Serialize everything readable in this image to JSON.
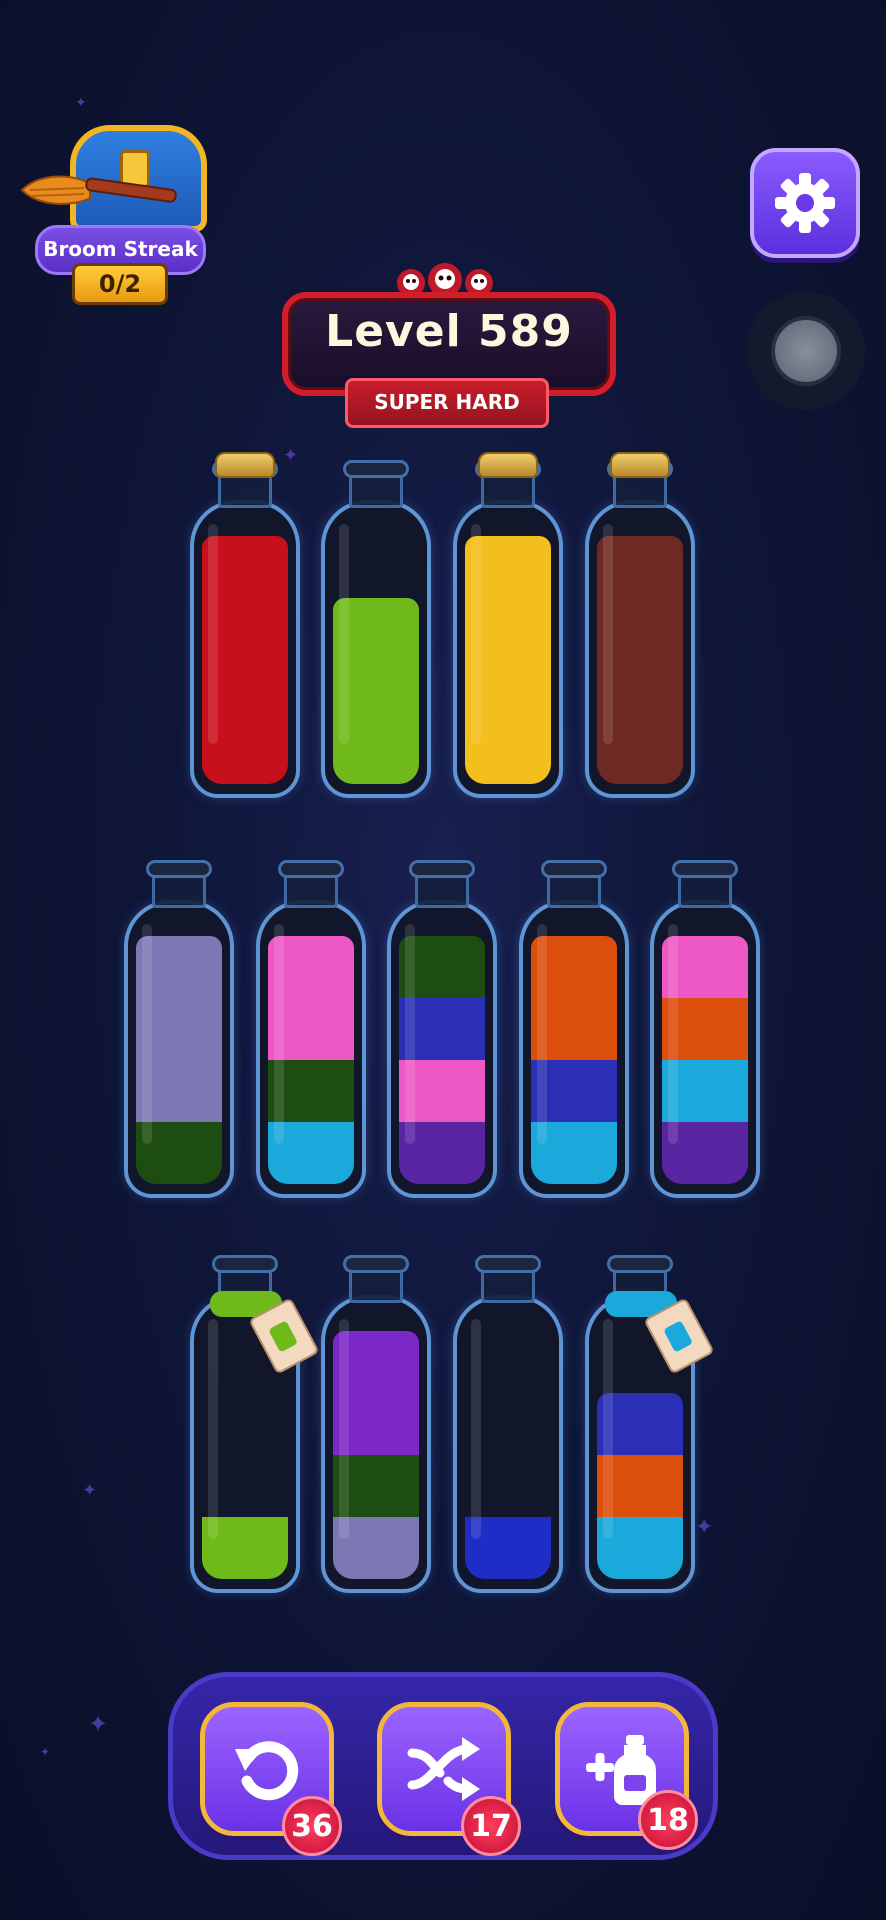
{
  "streak": {
    "label": "Broom Streak",
    "count": "0/2",
    "icons": [
      "chest-icon",
      "broom-icon"
    ]
  },
  "settings": {
    "icon": "gear-icon"
  },
  "level": {
    "title": "Level 589",
    "difficulty": "SUPER HARD",
    "skull_icons": [
      "skull-icon",
      "skull-icon",
      "skull-icon"
    ]
  },
  "colors": {
    "red": "#c8101c",
    "lime": "#6fba1a",
    "yellow": "#f3bf1c",
    "brown": "#6e2a22",
    "lavender": "#7c78b4",
    "darkgreen": "#1e4d12",
    "pink": "#ee58c4",
    "cyan": "#1ba8da",
    "blue": "#2a2fb6",
    "orange": "#db4e0c",
    "purple": "#5a25a2",
    "violet": "#7c27c8",
    "deepblue": "#1f2dc6"
  },
  "bottles": [
    {
      "row": 1,
      "corked": true,
      "layers": [
        "red",
        "red",
        "red",
        "red"
      ]
    },
    {
      "row": 1,
      "corked": false,
      "layers": [
        "lime",
        "lime",
        "lime"
      ]
    },
    {
      "row": 1,
      "corked": true,
      "layers": [
        "yellow",
        "yellow",
        "yellow",
        "yellow"
      ]
    },
    {
      "row": 1,
      "corked": true,
      "layers": [
        "brown",
        "brown",
        "brown",
        "brown"
      ]
    },
    {
      "row": 2,
      "corked": false,
      "layers": [
        "darkgreen",
        "lavender",
        "lavender",
        "lavender"
      ]
    },
    {
      "row": 2,
      "corked": false,
      "layers": [
        "cyan",
        "darkgreen",
        "pink",
        "pink"
      ]
    },
    {
      "row": 2,
      "corked": false,
      "layers": [
        "purple",
        "pink",
        "blue",
        "darkgreen"
      ]
    },
    {
      "row": 2,
      "corked": false,
      "layers": [
        "cyan",
        "blue",
        "orange",
        "orange"
      ]
    },
    {
      "row": 2,
      "corked": false,
      "layers": [
        "purple",
        "cyan",
        "orange",
        "pink"
      ]
    },
    {
      "row": 3,
      "corked": false,
      "locked": "lime",
      "layers": [
        "lime"
      ]
    },
    {
      "row": 3,
      "corked": false,
      "layers": [
        "lavender",
        "darkgreen",
        "violet",
        "violet"
      ]
    },
    {
      "row": 3,
      "corked": false,
      "layers": [
        "deepblue"
      ]
    },
    {
      "row": 3,
      "corked": false,
      "locked": "cyan",
      "layers": [
        "cyan",
        "orange",
        "blue"
      ]
    }
  ],
  "powerups": [
    {
      "name": "undo",
      "icon": "undo-icon",
      "count": "36"
    },
    {
      "name": "shuffle",
      "icon": "shuffle-icon",
      "count": "17"
    },
    {
      "name": "add-bottle",
      "icon": "add-bottle-icon",
      "count": "18"
    }
  ]
}
